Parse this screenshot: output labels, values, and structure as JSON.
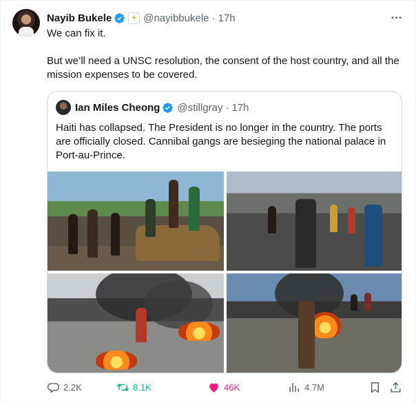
{
  "tweet": {
    "author_name": "Nayib Bukele",
    "author_handle": "@nayibbukele",
    "separator": "·",
    "time": "17h",
    "text_lines": [
      "We can fix it.",
      "But we’ll need a UNSC resolution, the consent of the host country, and all the mission expenses to be covered."
    ],
    "verified_color": "#1d9bf0"
  },
  "quoted": {
    "author_name": "Ian Miles Cheong",
    "author_handle": "@stillgray",
    "separator": "·",
    "time": "17h",
    "text": "Haiti has collapsed. The President is no longer in the country. The ports are officially closed. Cannibal gangs are besieging the national palace in Port-au-Prince.",
    "media": [
      "photo-crowd-burned-car",
      "photo-street-men-running",
      "photo-burning-tires-smoke",
      "photo-man-near-fire"
    ]
  },
  "actions": {
    "reply_count": "2.2K",
    "retweet_count": "8.1K",
    "like_count": "46K",
    "view_count": "4.7M"
  },
  "icons": [
    "verified-badge-icon",
    "affiliation-badge-icon",
    "more-icon",
    "reply-icon",
    "retweet-icon",
    "heart-icon",
    "views-icon",
    "bookmark-icon",
    "share-icon"
  ],
  "colors": {
    "retweeted": "#00ba7c",
    "liked": "#f91880",
    "secondary_text": "#536471"
  }
}
